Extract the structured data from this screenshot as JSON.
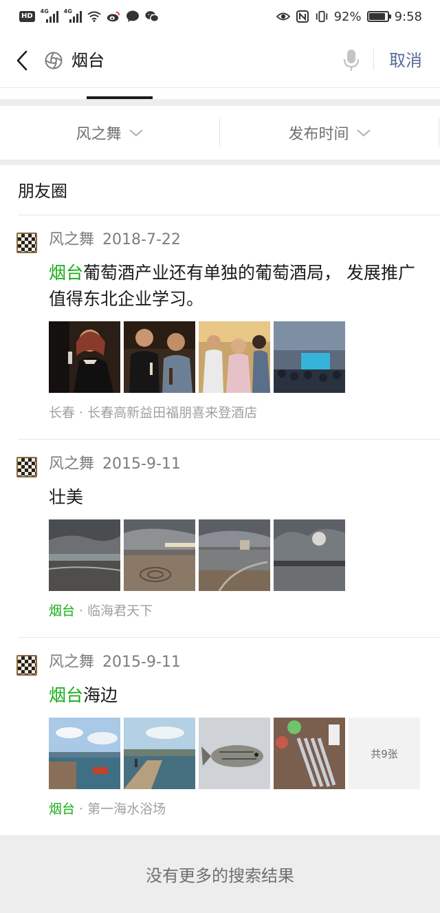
{
  "status_bar": {
    "hd_label": "HD",
    "network_1": "4G",
    "network_2": "4G",
    "battery_percent": "92%",
    "battery_level": 0.92,
    "time": "9:58",
    "icons": [
      "hd-icon",
      "signal-icon",
      "signal-icon",
      "wifi-icon",
      "weibo-icon",
      "chat-bubble-icon",
      "wechat-icon",
      "eye-icon",
      "nfc-icon",
      "vibrate-icon",
      "battery-icon"
    ]
  },
  "header": {
    "query": "烟台",
    "cancel_label": "取消",
    "accent_color": "#576b95"
  },
  "filters": [
    {
      "label": "风之舞"
    },
    {
      "label": "发布时间"
    }
  ],
  "section": {
    "title": "朋友圈"
  },
  "highlight_color": "#1aad19",
  "posts": [
    {
      "author": "风之舞",
      "date": "2018-7-22",
      "text_highlight": "烟台",
      "text_rest": "葡萄酒产业还有单独的葡萄酒局， 发展推广值得东北企业学习。",
      "location_city": "长春",
      "location_sep": " · ",
      "location_place": "长春高新益田福朋喜来登酒店"
    },
    {
      "author": "风之舞",
      "date": "2015-9-11",
      "text_highlight": "",
      "text_rest": "壮美",
      "location_city": "烟台",
      "location_sep": " · ",
      "location_place": "临海君天下"
    },
    {
      "author": "风之舞",
      "date": "2015-9-11",
      "text_highlight": "烟台",
      "text_rest": "海边",
      "location_city": "烟台",
      "location_sep": " · ",
      "location_place": "第一海水浴场",
      "more_label": "共9张"
    }
  ],
  "footer": {
    "label": "没有更多的搜索结果"
  }
}
